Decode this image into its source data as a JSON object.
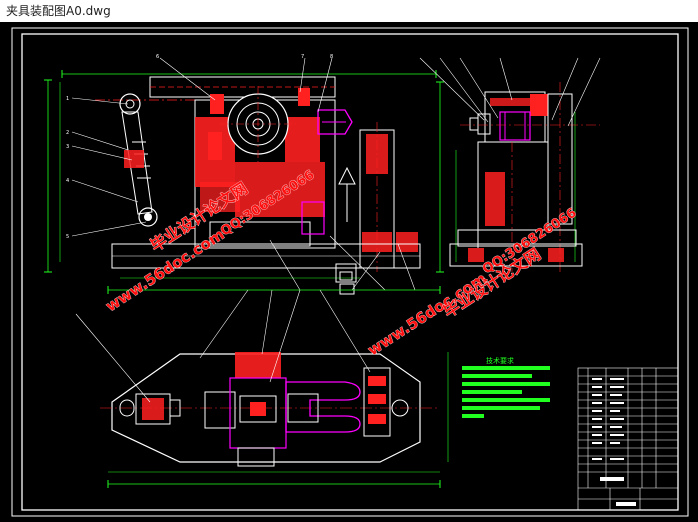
{
  "window": {
    "title": "夹具装配图A0.dwg"
  },
  "colors": {
    "background": "#000000",
    "frame": "#ffffff",
    "part_outline": "#ffffff",
    "hatch": "#ff2020",
    "centerline": "#ff2020",
    "dimension": "#20ff20",
    "leader": "#ffffff",
    "highlight": "#ff00ff",
    "notes": "#20ff20",
    "watermark": "#ff1010"
  },
  "watermarks": {
    "site_url": "www.56doc.com",
    "site_name": "毕业设计论文网",
    "qq": "QQ:306826066"
  },
  "notes": {
    "heading": "技术要求"
  }
}
